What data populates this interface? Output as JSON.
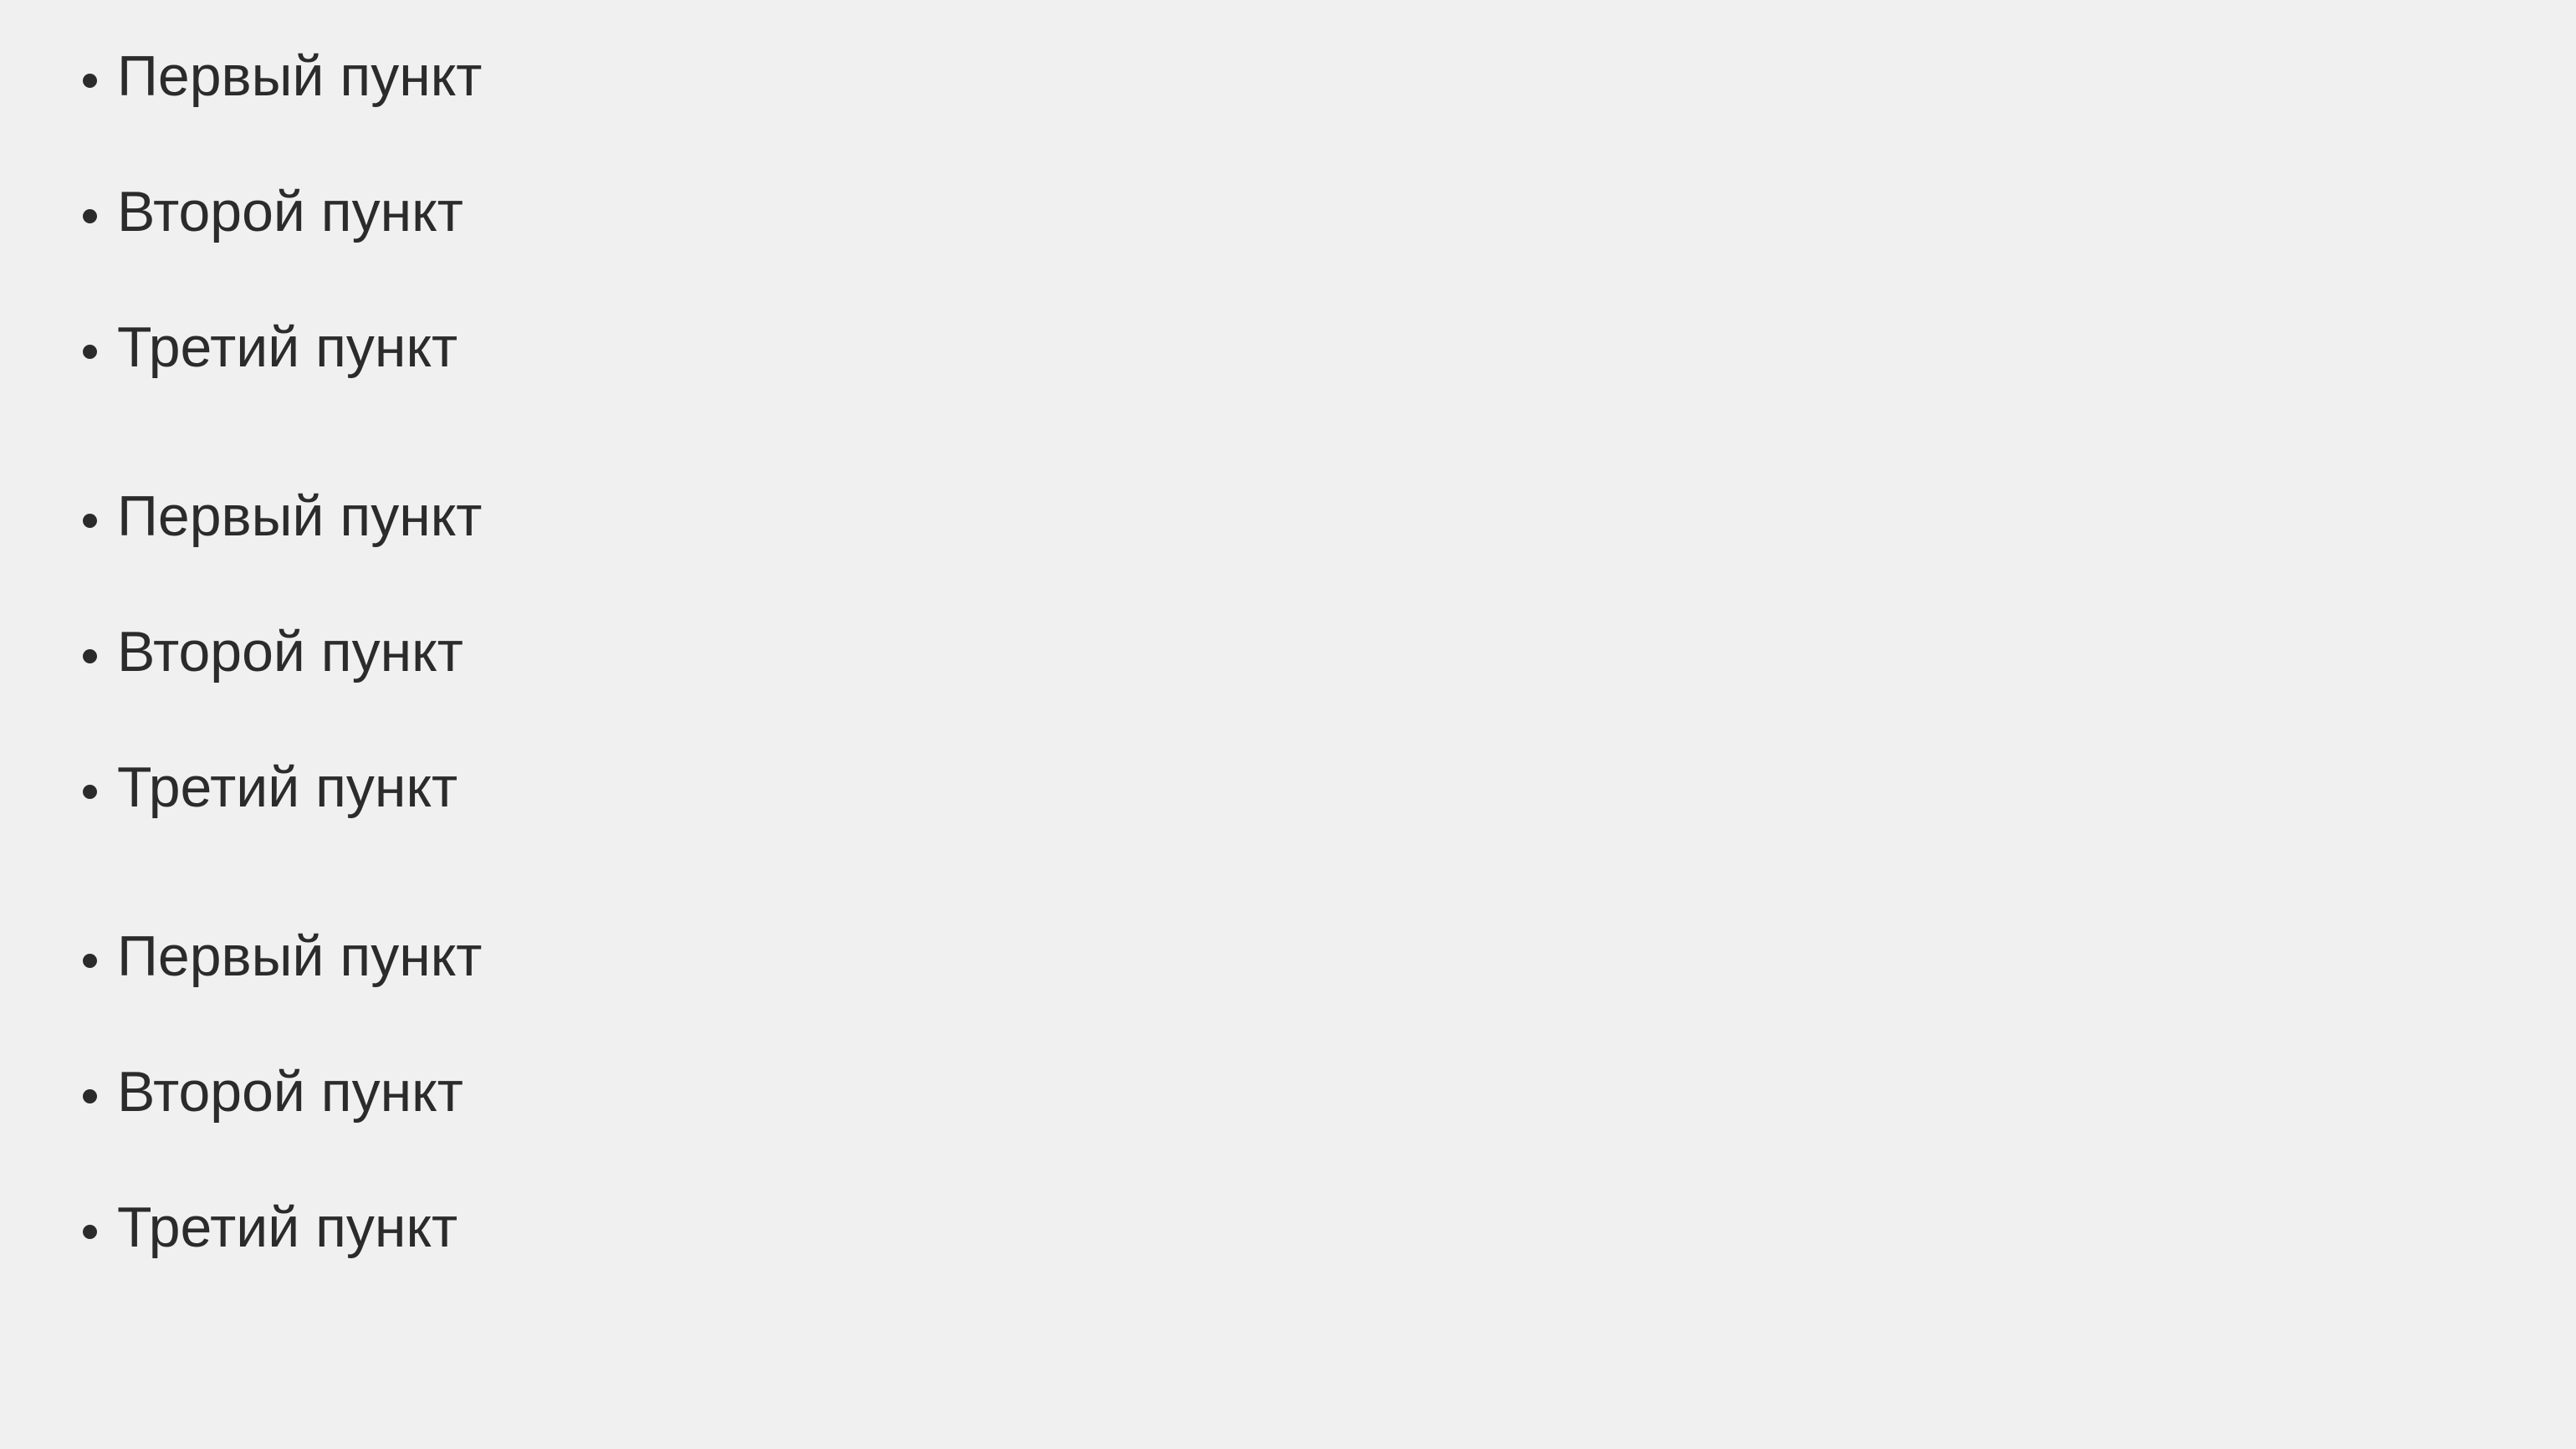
{
  "lists": [
    {
      "items": [
        "Первый пункт",
        "Второй пункт",
        "Третий пункт"
      ]
    },
    {
      "items": [
        "Первый пункт",
        "Второй пункт",
        "Третий пункт"
      ]
    },
    {
      "items": [
        "Первый пункт",
        "Второй пункт",
        "Третий пункт"
      ]
    }
  ]
}
